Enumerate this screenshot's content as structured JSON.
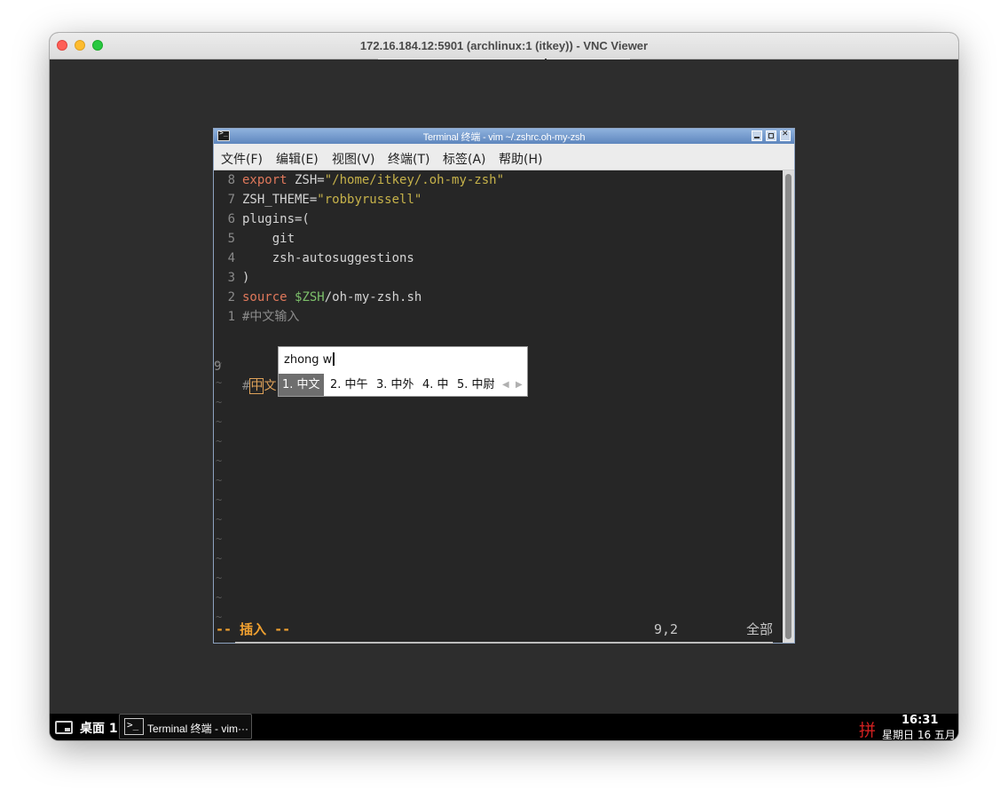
{
  "viewer": {
    "title": "172.16.184.12:5901 (archlinux:1 (itkey)) - VNC Viewer"
  },
  "terminal": {
    "title": "Terminal 终端 - vim ~/.zshrc.oh-my-zsh",
    "menu": [
      "文件(F)",
      "编辑(E)",
      "视图(V)",
      "终端(T)",
      "标签(A)",
      "帮助(H)"
    ]
  },
  "vim": {
    "lines": [
      {
        "num": "8",
        "tokens": [
          {
            "t": "export",
            "c": "kw"
          },
          {
            "t": " ZSH=",
            "c": "pl"
          },
          {
            "t": "\"/home/itkey/.oh-my-zsh\"",
            "c": "str"
          }
        ]
      },
      {
        "num": "7",
        "tokens": [
          {
            "t": "ZSH_THEME=",
            "c": "pl"
          },
          {
            "t": "\"robbyrussell\"",
            "c": "str"
          }
        ]
      },
      {
        "num": "6",
        "tokens": [
          {
            "t": "plugins=(",
            "c": "pl"
          }
        ]
      },
      {
        "num": "5",
        "tokens": [
          {
            "t": "    git",
            "c": "pl"
          }
        ]
      },
      {
        "num": "4",
        "tokens": [
          {
            "t": "    zsh-autosuggestions",
            "c": "pl"
          }
        ]
      },
      {
        "num": "3",
        "tokens": [
          {
            "t": ")",
            "c": "pl"
          }
        ]
      },
      {
        "num": "2",
        "tokens": [
          {
            "t": "source",
            "c": "kw"
          },
          {
            "t": " ",
            "c": "pl"
          },
          {
            "t": "$ZSH",
            "c": "var"
          },
          {
            "t": "/oh-my-zsh.sh",
            "c": "pl"
          }
        ]
      },
      {
        "num": "1",
        "tokens": [
          {
            "t": "#中文输入",
            "c": "cmt"
          }
        ]
      }
    ],
    "current_line": {
      "num": "9",
      "prefix": "#",
      "cursor_char": "中",
      "rest": "文"
    },
    "empty_line_marker": "~",
    "mode": "-- 插入 --",
    "position": "9,2",
    "percent": "全部"
  },
  "ime": {
    "input": "zhong w",
    "candidates": [
      "1. 中文",
      "2. 中午",
      "3. 中外",
      "4. 中",
      "5. 中尉"
    ],
    "selected_index": 0,
    "prev_arrow": "◀",
    "next_arrow": "▶"
  },
  "taskbar": {
    "desktop_label": "桌面 1",
    "task_label": "Terminal 终端 - vim···",
    "ime_indicator": "拼",
    "time": "16:31",
    "date": "星期日 16 五月"
  }
}
